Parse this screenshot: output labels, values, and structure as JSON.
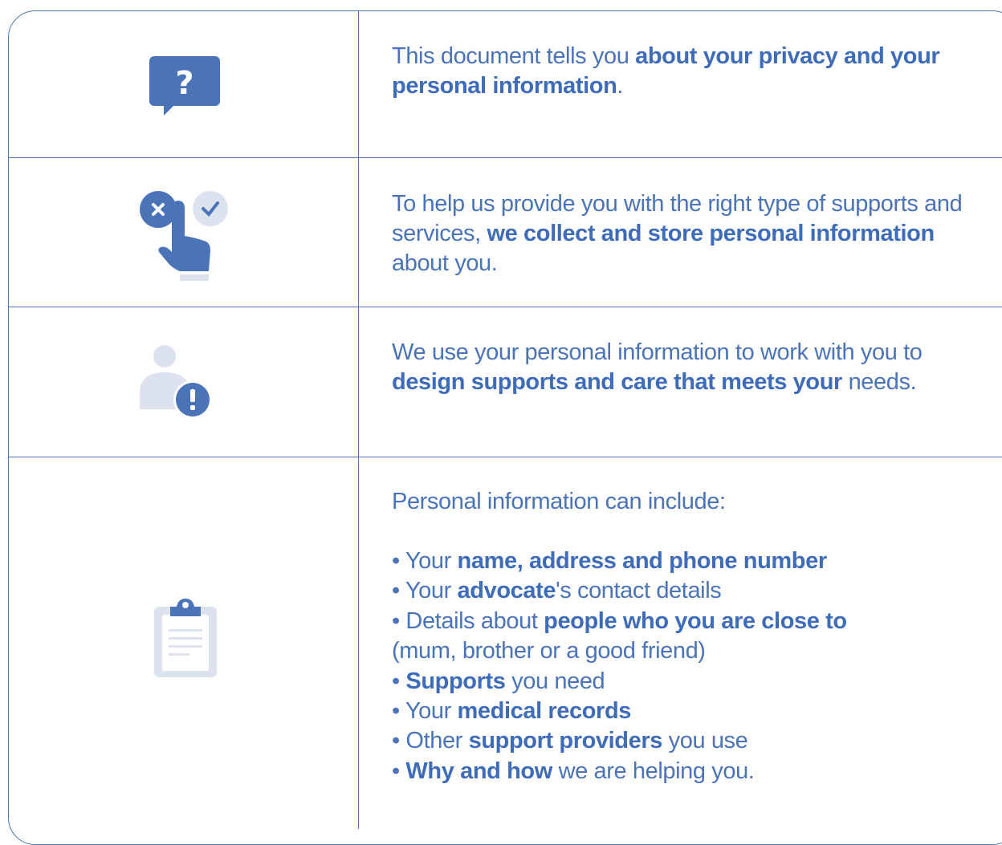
{
  "rows": [
    {
      "icon": "question-speech-bubble-icon",
      "text": {
        "p1": "This document tells you ",
        "b1": "about your privacy and your personal information",
        "p2": "."
      }
    },
    {
      "icon": "choose-finger-icon",
      "text": {
        "p1": "To help us provide you with the right type of supports and services, ",
        "b1": "we collect and store personal information",
        "p2": " about you."
      }
    },
    {
      "icon": "person-alert-icon",
      "text": {
        "p1": "We use your personal information to work with you to ",
        "b1": "design supports and care that meets your",
        "p2": " needs."
      }
    },
    {
      "icon": "clipboard-icon",
      "intro": "Personal information can include:",
      "items": [
        {
          "pre": "• Your ",
          "bold": "name, address and phone number",
          "post": ""
        },
        {
          "pre": "• Your ",
          "bold": "advocate",
          "post": "'s contact details"
        },
        {
          "pre": "• Details about ",
          "bold": "people who you are close to",
          "post": ""
        },
        {
          "pre": "(mum, brother or a good friend)",
          "bold": "",
          "post": ""
        },
        {
          "pre": "• ",
          "bold": "Supports",
          "post": " you need"
        },
        {
          "pre": "• Your ",
          "bold": "medical records",
          "post": ""
        },
        {
          "pre": "• Other ",
          "bold": "support providers",
          "post": " you use"
        },
        {
          "pre": "• ",
          "bold": "Why and how",
          "post": " we are helping you."
        }
      ]
    }
  ],
  "colors": {
    "accent": "#4a73b8",
    "light": "#dde3ee"
  }
}
